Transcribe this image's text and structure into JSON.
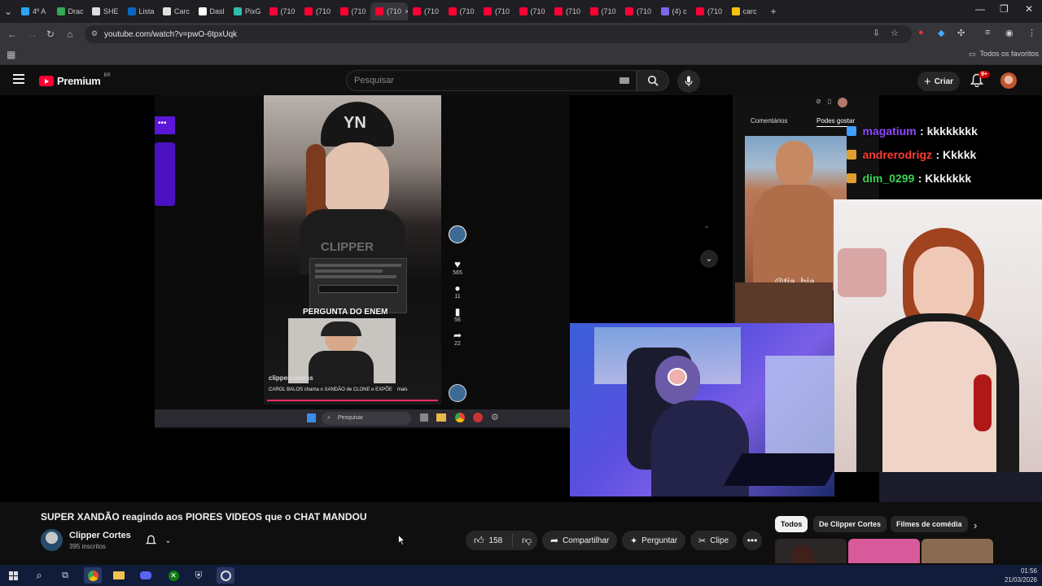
{
  "browser": {
    "tabs": [
      {
        "label": "4º A",
        "color": "#2aa4f4"
      },
      {
        "label": "Drac",
        "color": "#34a853"
      },
      {
        "label": "SHE",
        "color": "#dddddd"
      },
      {
        "label": "Lista",
        "color": "#0a66c2"
      },
      {
        "label": "Carc",
        "color": "#e0e0e0"
      },
      {
        "label": "Dasl",
        "color": "#ffffff"
      },
      {
        "label": "PixG",
        "color": "#32bcad"
      },
      {
        "label": "(710",
        "color": "#ff0033"
      },
      {
        "label": "(710",
        "color": "#ff0033"
      },
      {
        "label": "(710",
        "color": "#ff0033"
      },
      {
        "label": "(710",
        "color": "#ff0033"
      },
      {
        "label": "(710",
        "color": "#ff0033"
      },
      {
        "label": "(710",
        "color": "#ff0033"
      },
      {
        "label": "(710",
        "color": "#ff0033"
      },
      {
        "label": "(710",
        "color": "#ff0033"
      },
      {
        "label": "(710",
        "color": "#ff0033"
      },
      {
        "label": "(710",
        "color": "#ff0033"
      },
      {
        "label": "(710",
        "color": "#ff0033"
      },
      {
        "label": "(4) c",
        "color": "#7b68ee"
      },
      {
        "label": "(710",
        "color": "#ff0033"
      },
      {
        "label": "carc",
        "color": "#f4c20d"
      }
    ],
    "url": "youtube.com/watch?v=pwO-6tpxUqk",
    "bookmarks_all": "Todos os favoritos"
  },
  "youtube": {
    "logo_text": "Premium",
    "logo_region": "BR",
    "search_placeholder": "Pesquisar",
    "create_label": "Criar",
    "notifications_badge": "9+"
  },
  "video_overlay": {
    "chat": [
      {
        "user": "magatium",
        "message": ": kkkkkkkk",
        "color": "#9147ff"
      },
      {
        "user": "andrerodrigz",
        "message": ": Kkkkk",
        "color": "#ff3b30"
      },
      {
        "user": "dim_0299",
        "message": ": Kkkkkkk",
        "color": "#39d353"
      }
    ],
    "panel_tabs": [
      "Comentários",
      "Podes gostar"
    ],
    "watermark_muscle": "@tia_bia",
    "tiktok_caption_title": "PERGUNTA DO ENEM",
    "tiktok_handle": "clippercortess",
    "tiktok_desc": "CAROL BALOS chama o XANDÃO de CLONE e EXPÕE",
    "tiktok_more": "mais",
    "tiktok_counts": [
      "565",
      "11",
      "56",
      "22"
    ],
    "tiktok_watermark": "CLIPPER",
    "inner_search": "Pesquisar"
  },
  "video_info": {
    "title": "SUPER XANDÃO reagindo aos PIORES VIDEOS que o CHAT MANDOU",
    "channel": "Clipper Cortes",
    "subscribers": "395 inscritos",
    "likes": "158",
    "share": "Compartilhar",
    "ask": "Perguntar",
    "clip": "Clipe"
  },
  "chips": [
    "Todos",
    "De Clipper Cortes",
    "Filmes de comédia"
  ],
  "taskbar": {
    "time": "01:56",
    "date": "21/03/2026"
  },
  "colors": {
    "accent_red": "#ff0033",
    "youtube_bg": "#0f0f0f",
    "taskbar": "#101c3a"
  }
}
